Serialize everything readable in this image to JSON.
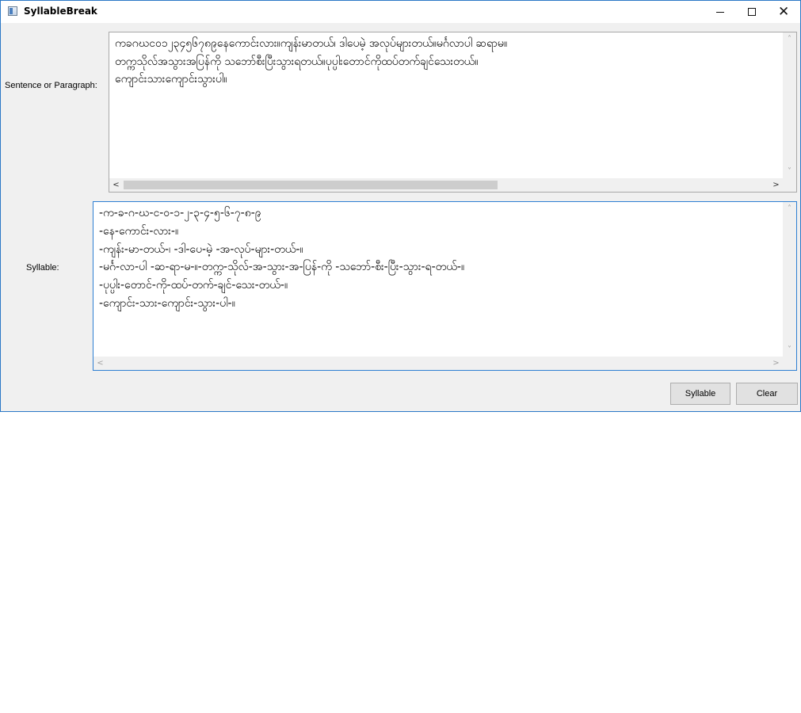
{
  "window": {
    "title": "SyllableBreak"
  },
  "titlebar_buttons": {
    "close_glyph": "✕"
  },
  "form": {
    "sentence_label": "Sentence or Paragraph:",
    "syllable_label": "Syllable:",
    "sentence_lines": [
      "ကခဂဃင၀၁၂၃၄၅၆၇၈၉နေကောင်းလား။ကျန်းမာတယ်၊ ဒါပေမဲ့ အလုပ်များတယ်။မင်္ဂလာပါ ဆရာမ။",
      "တက္ကသိုလ်အသွားအပြန်ကို သဘော်စီးပြီးသွားရတယ်။ပုပ္ပါးတောင်ကိုထပ်တက်ချင်သေးတယ်။",
      "ကျောင်းသားကျောင်းသွားပါ။"
    ],
    "syllable_lines": [
      "-က-ခ-ဂ-ဃ-င-၀-၁-၂-၃-၄-၅-၆-၇-၈-၉",
      "-နေ-ကောင်း-လား-။",
      "-ကျန်း-မာ-တယ်-၊ -ဒါ-ပေ-မဲ့ -အ-လုပ်-များ-တယ်-။",
      "-မင်္ဂ-လာ-ပါ -ဆ-ရာ-မ-။-တက္က-သိုလ်-အ-သွား-အ-ပြန်-ကို -သဘော်-စီး-ပြီး-သွား-ရ-တယ်-။",
      "-ပုပ္ပါး-တောင်-ကို-ထပ်-တက်-ချင်-သေး-တယ်-။",
      "-ကျောင်း-သား-ကျောင်း-သွား-ပါ-။"
    ]
  },
  "buttons": {
    "syllable": "Syllable",
    "clear": "Clear"
  },
  "scrollbars": {
    "up": "˄",
    "down": "˅",
    "left": "<",
    "right": ">",
    "sentence_h_thumb_fraction": 0.58
  }
}
